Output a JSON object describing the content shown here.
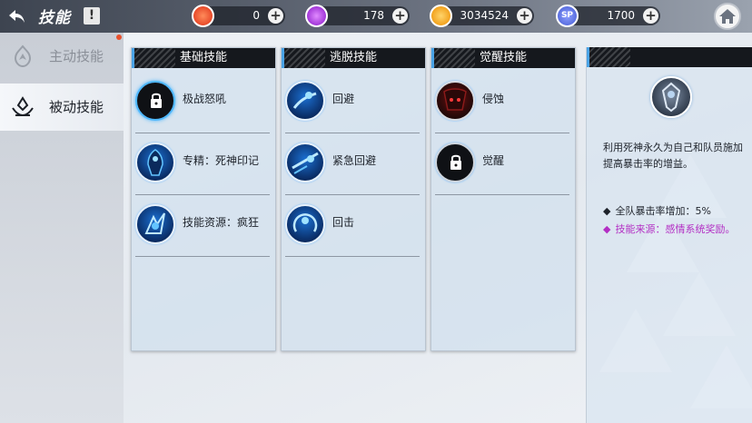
{
  "header": {
    "title": "技能",
    "info_symbol": "!"
  },
  "resources": [
    {
      "name": "red-currency",
      "value": "0",
      "color": "#e84a2a"
    },
    {
      "name": "purple-crystal",
      "value": "178",
      "color": "#a236d8"
    },
    {
      "name": "gold-coin",
      "value": "3034524",
      "color": "#f2a21e"
    },
    {
      "name": "sp",
      "value": "1700",
      "color": "#5a6fe0",
      "label": "SP"
    }
  ],
  "sidebar": {
    "items": [
      {
        "label": "主动技能",
        "active": false
      },
      {
        "label": "被动技能",
        "active": true
      }
    ]
  },
  "columns": [
    {
      "header": "基础技能",
      "skills": [
        {
          "label": "极战怒吼",
          "state": "selected-locked"
        },
        {
          "label": "专精：死神印记",
          "state": "blue"
        },
        {
          "label": "技能资源：疯狂",
          "state": "blue"
        }
      ]
    },
    {
      "header": "逃脱技能",
      "skills": [
        {
          "label": "回避",
          "state": "blue"
        },
        {
          "label": "紧急回避",
          "state": "blue"
        },
        {
          "label": "回击",
          "state": "blue"
        }
      ]
    },
    {
      "header": "觉醒技能",
      "skills": [
        {
          "label": "侵蚀",
          "state": "red"
        },
        {
          "label": "觉醒",
          "state": "locked"
        }
      ]
    }
  ],
  "detail": {
    "description": "利用死神永久为自己和队员施加提高暴击率的增益。",
    "bullets": [
      {
        "text": "全队暴击率增加：5%",
        "color": "#1d222a"
      },
      {
        "text": "技能来源：感情系统奖励。",
        "color": "#b32fc4"
      }
    ],
    "bullet_symbol": "◆"
  },
  "colors": {
    "accent_blue": "#4fb8ff",
    "highlight_purple": "#b32fc4"
  }
}
